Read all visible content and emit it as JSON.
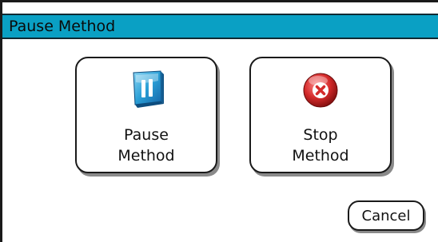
{
  "window": {
    "title": "Pause Method"
  },
  "actions": {
    "pause": {
      "label_line1": "Pause",
      "label_line2": "Method",
      "icon": "pause-icon"
    },
    "stop": {
      "label_line1": "Stop",
      "label_line2": "Method",
      "icon": "stop-x-icon"
    }
  },
  "footer": {
    "cancel_label": "Cancel"
  },
  "colors": {
    "title_bar": "#0aa0c4",
    "pause_icon": "#2a9fd6",
    "stop_icon": "#d42a2a"
  }
}
